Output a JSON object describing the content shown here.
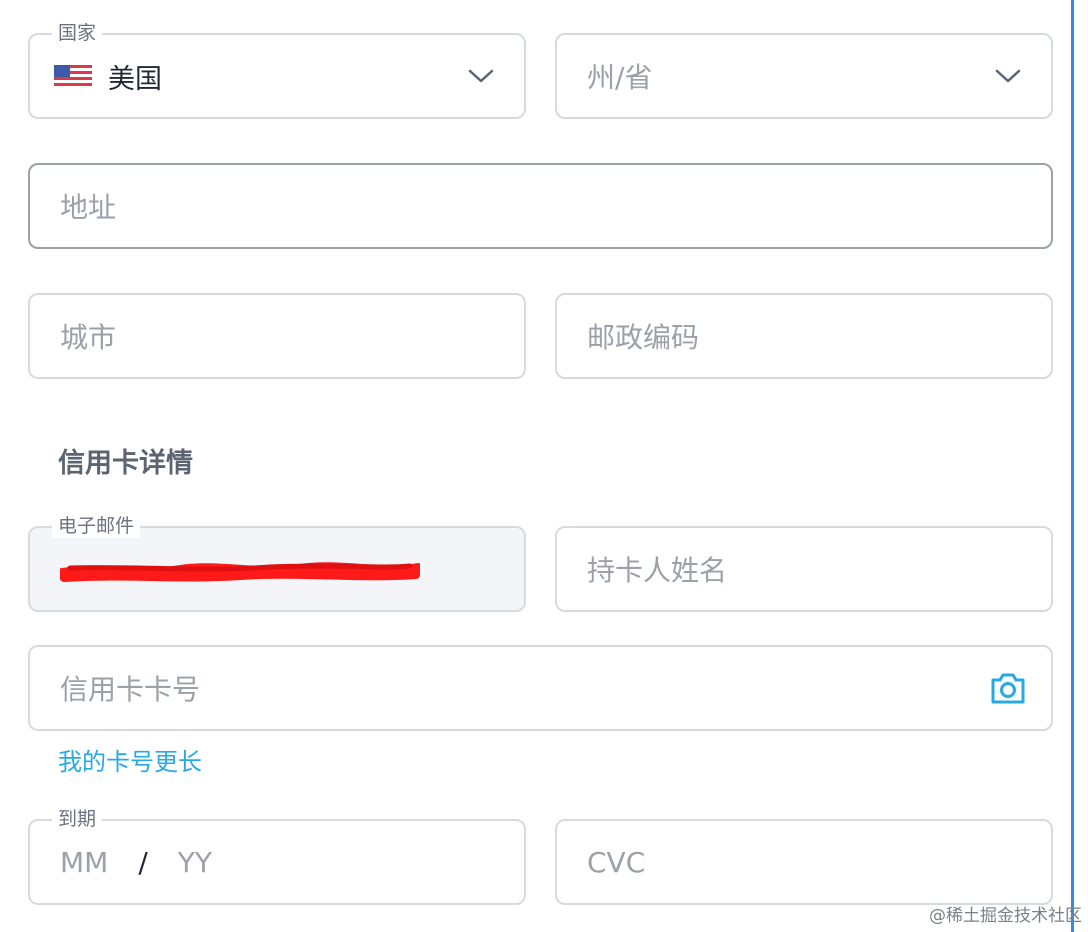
{
  "country": {
    "legend": "国家",
    "value": "美国",
    "flag_icon": "us-flag-icon"
  },
  "state": {
    "placeholder": "州/省"
  },
  "address": {
    "placeholder": "地址"
  },
  "city": {
    "placeholder": "城市"
  },
  "postal_code": {
    "placeholder": "邮政编码"
  },
  "credit_card_section": {
    "title": "信用卡详情"
  },
  "email": {
    "legend": "电子邮件",
    "value_note": "redacted"
  },
  "cardholder_name": {
    "placeholder": "持卡人姓名"
  },
  "card_number": {
    "placeholder": "信用卡卡号",
    "camera_icon": "camera-icon"
  },
  "longer_card_link": {
    "label": "我的卡号更长"
  },
  "expiry": {
    "legend": "到期",
    "month_placeholder": "MM",
    "separator": "/",
    "year_placeholder": "YY"
  },
  "cvc": {
    "placeholder": "CVC"
  },
  "watermark": {
    "text": "@稀土掘金技术社区"
  },
  "colors": {
    "accent": "#27a9e1",
    "border": "#d7dbe0",
    "placeholder": "#9aa1a9",
    "redaction": "#ff1a1a"
  }
}
